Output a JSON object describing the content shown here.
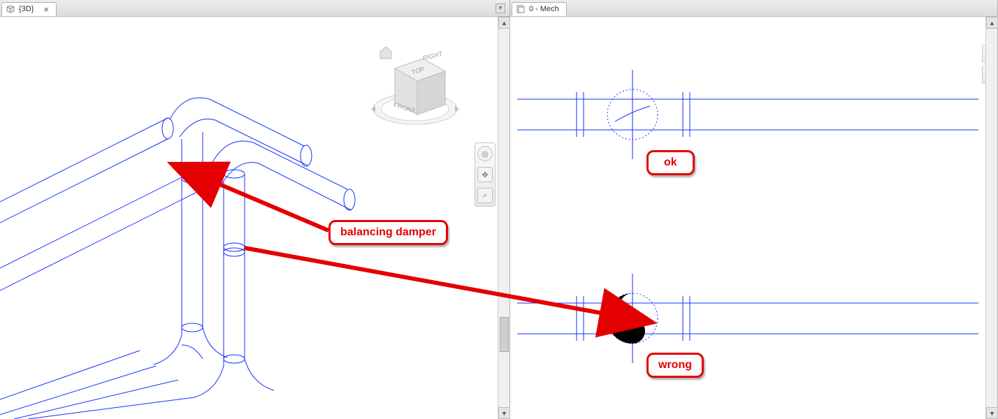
{
  "tabs": {
    "left": {
      "label": "{3D}",
      "close": "×"
    },
    "right": {
      "label": "0 - Mech"
    }
  },
  "viewcube": {
    "top": "TOP",
    "front": "FRONT",
    "right": "RIGHT"
  },
  "annotations": {
    "balancing_damper": "balancing damper",
    "ok": "ok",
    "wrong": "wrong"
  },
  "colors": {
    "line": "#1030ff",
    "annotation": "#e40000",
    "viewcube_fill": "#e7e7e7",
    "viewcube_edge": "#bcbcbc"
  }
}
